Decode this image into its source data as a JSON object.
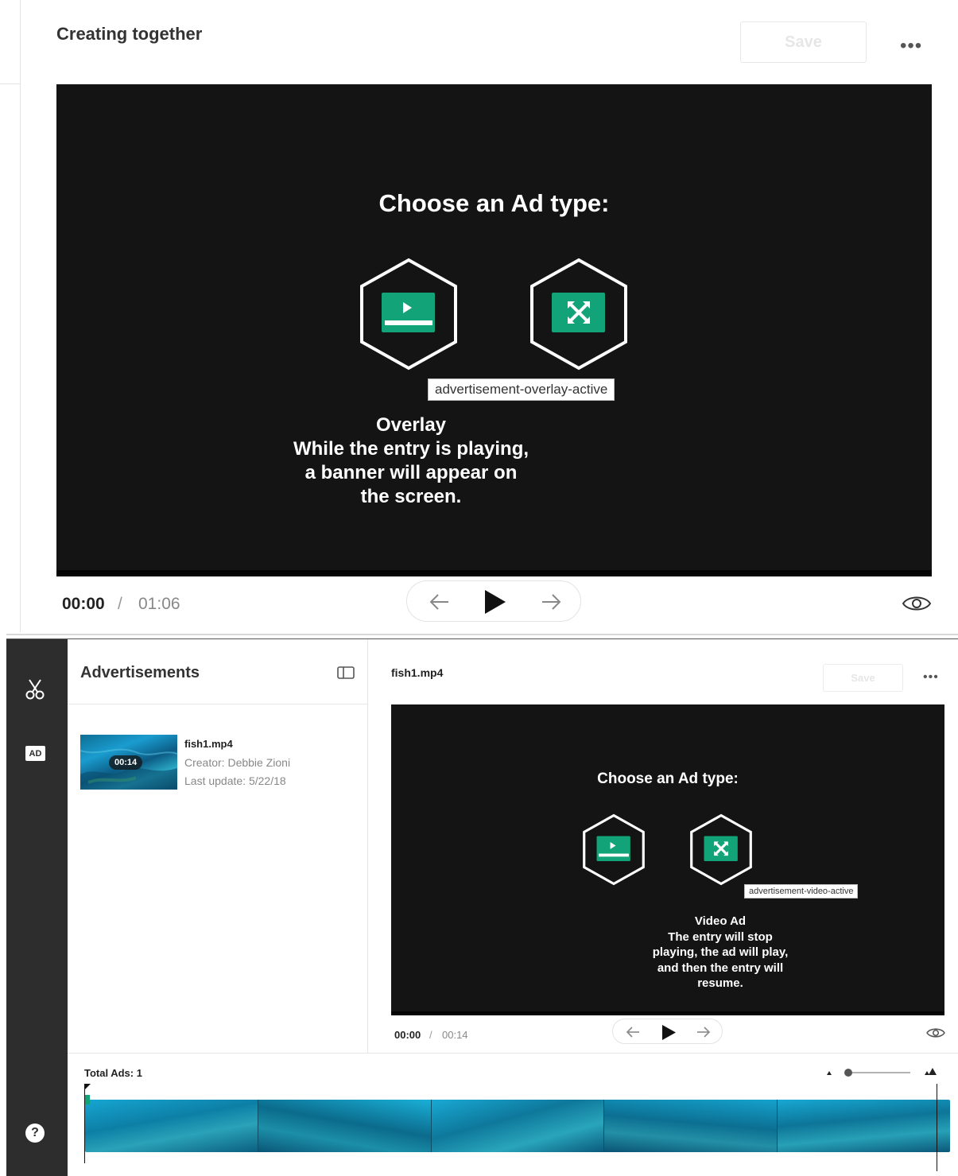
{
  "top": {
    "title": "Creating together",
    "save_label": "Save",
    "more_label": "•••",
    "player": {
      "heading": "Choose an Ad type:",
      "tooltip": "advertisement-overlay-active",
      "description_lines": [
        "Overlay",
        "While the entry is playing,",
        "a banner will appear on",
        "the screen."
      ]
    },
    "time": {
      "current": "00:00",
      "separator": "/",
      "total": "01:06"
    }
  },
  "bottom": {
    "rail": {
      "ad_badge": "AD",
      "help_label": "?"
    },
    "list": {
      "header": "Advertisements",
      "items": [
        {
          "name": "fish1.mp4",
          "duration": "00:14",
          "creator": "Creator: Debbie Zioni",
          "updated": "Last update: 5/22/18"
        }
      ]
    },
    "editor": {
      "file_name": "fish1.mp4",
      "save_label": "Save",
      "more_label": "•••",
      "player": {
        "heading": "Choose an Ad type:",
        "tooltip": "advertisement-video-active",
        "description_lines": [
          "Video Ad",
          "The entry will stop",
          "playing, the ad will play,",
          "and then the entry will",
          "resume."
        ]
      },
      "time": {
        "current": "00:00",
        "separator": "/",
        "total": "00:14"
      }
    },
    "timeline": {
      "total_ads": "Total Ads: 1",
      "frame_count": 5,
      "zoom_level": 0.0
    }
  },
  "colors": {
    "accent_green": "#13a378",
    "player_bg": "#141414",
    "rail_bg": "#2d2d2d"
  }
}
